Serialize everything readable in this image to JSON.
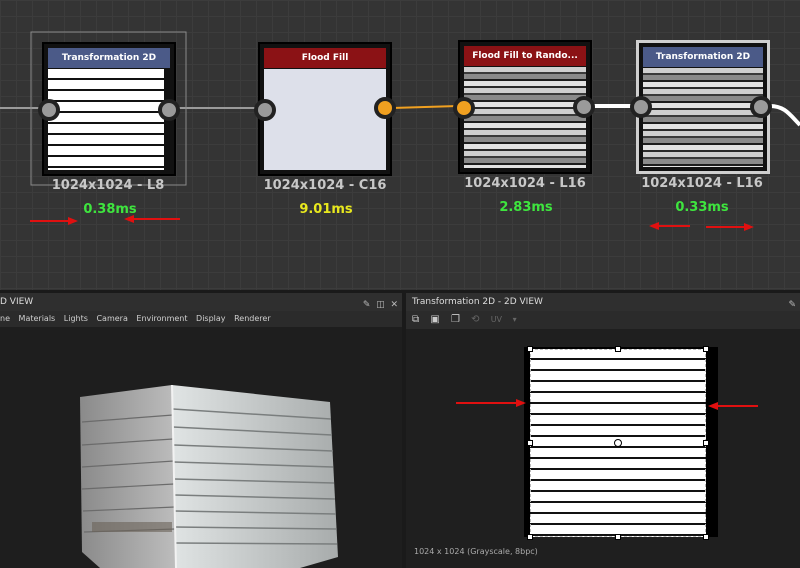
{
  "nodes": [
    {
      "title": "Transformation 2D",
      "resolution": "1024x1024 - L8",
      "time": "0.38ms",
      "header_color": "#4b5a88",
      "time_color": "#3ee53e"
    },
    {
      "title": "Flood Fill",
      "resolution": "1024x1024 - C16",
      "time": "9.01ms",
      "header_color": "#8b1215",
      "time_color": "#e8e81e"
    },
    {
      "title": "Flood Fill to Rando...",
      "resolution": "1024x1024 - L16",
      "time": "2.83ms",
      "header_color": "#8b1215",
      "time_color": "#3ee53e"
    },
    {
      "title": "Transformation 2D",
      "resolution": "1024x1024 - L16",
      "time": "0.33ms",
      "header_color": "#4b5a88",
      "time_color": "#3ee53e"
    }
  ],
  "view3d": {
    "title": "D VIEW",
    "menu": [
      "ne",
      "Materials",
      "Lights",
      "Camera",
      "Environment",
      "Display",
      "Renderer"
    ]
  },
  "view2d": {
    "title": "Transformation 2D - 2D VIEW",
    "footer": "1024 x 1024 (Grayscale, 8bpc)",
    "toolbar_icons": [
      "export-icon",
      "save-icon",
      "copy-icon",
      "uv-icon"
    ],
    "uv_label": "UV"
  },
  "colors": {
    "annotation_arrow": "#e01010",
    "port_orange": "#f0a020",
    "port_gray": "#9a9a9a"
  }
}
